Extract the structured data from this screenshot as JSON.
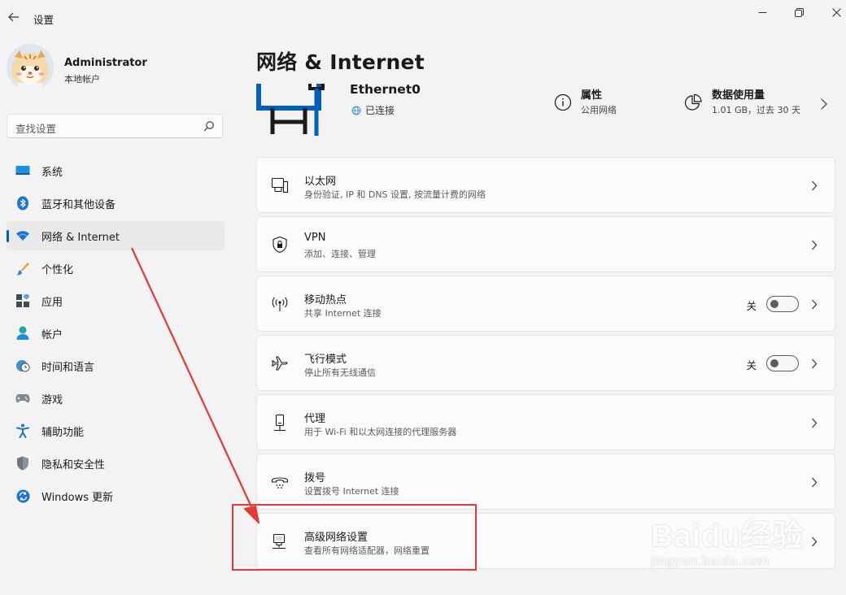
{
  "window": {
    "title": "设置",
    "back_icon": "back-arrow-icon",
    "controls": [
      "minimize-icon",
      "restore-icon",
      "close-icon"
    ]
  },
  "profile": {
    "name": "Administrator",
    "account_type": "本地帐户"
  },
  "search": {
    "placeholder": "查找设置"
  },
  "sidebar": {
    "items": [
      {
        "label": "系统",
        "icon": "system-icon",
        "active": false
      },
      {
        "label": "蓝牙和其他设备",
        "icon": "bluetooth-icon",
        "active": false
      },
      {
        "label": "网络 & Internet",
        "icon": "wifi-icon",
        "active": true
      },
      {
        "label": "个性化",
        "icon": "brush-icon",
        "active": false
      },
      {
        "label": "应用",
        "icon": "apps-icon",
        "active": false
      },
      {
        "label": "帐户",
        "icon": "person-icon",
        "active": false
      },
      {
        "label": "时间和语言",
        "icon": "globe-clock-icon",
        "active": false
      },
      {
        "label": "游戏",
        "icon": "gamepad-icon",
        "active": false
      },
      {
        "label": "辅助功能",
        "icon": "accessibility-icon",
        "active": false
      },
      {
        "label": "隐私和安全性",
        "icon": "shield-icon",
        "active": false
      },
      {
        "label": "Windows 更新",
        "icon": "update-icon",
        "active": false
      }
    ]
  },
  "main": {
    "title": "网络 & Internet",
    "ethernet": {
      "name": "Ethernet0",
      "status": "已连接",
      "properties_title": "属性",
      "properties_sub": "公用网络",
      "data_usage_title": "数据使用量",
      "data_usage_sub": "1.01 GB，过去 30 天"
    },
    "cards": [
      {
        "title": "以太网",
        "sub": "身份验证, IP 和 DNS 设置, 按流量计费的网络",
        "icon": "ethernet-icon"
      },
      {
        "title": "VPN",
        "sub": "添加、连接、管理",
        "icon": "vpn-shield-icon"
      },
      {
        "title": "移动热点",
        "sub": "共享 Internet 连接",
        "icon": "hotspot-icon",
        "toggle": "关"
      },
      {
        "title": "飞行模式",
        "sub": "停止所有无线通信",
        "icon": "airplane-icon",
        "toggle": "关"
      },
      {
        "title": "代理",
        "sub": "用于 Wi-Fi 和以太网连接的代理服务器",
        "icon": "proxy-icon"
      },
      {
        "title": "拨号",
        "sub": "设置拨号 Internet 连接",
        "icon": "dialup-icon"
      },
      {
        "title": "高级网络设置",
        "sub": "查看所有网络适配器，网络重置",
        "icon": "network-adapter-icon"
      }
    ]
  },
  "watermark": {
    "brand": "Baidu经验",
    "url": "jingyan.baidu.com"
  },
  "colors": {
    "accent": "#005fb8",
    "annotation": "#e53935",
    "background": "#f3f3f3",
    "card": "#fbfbfb"
  }
}
